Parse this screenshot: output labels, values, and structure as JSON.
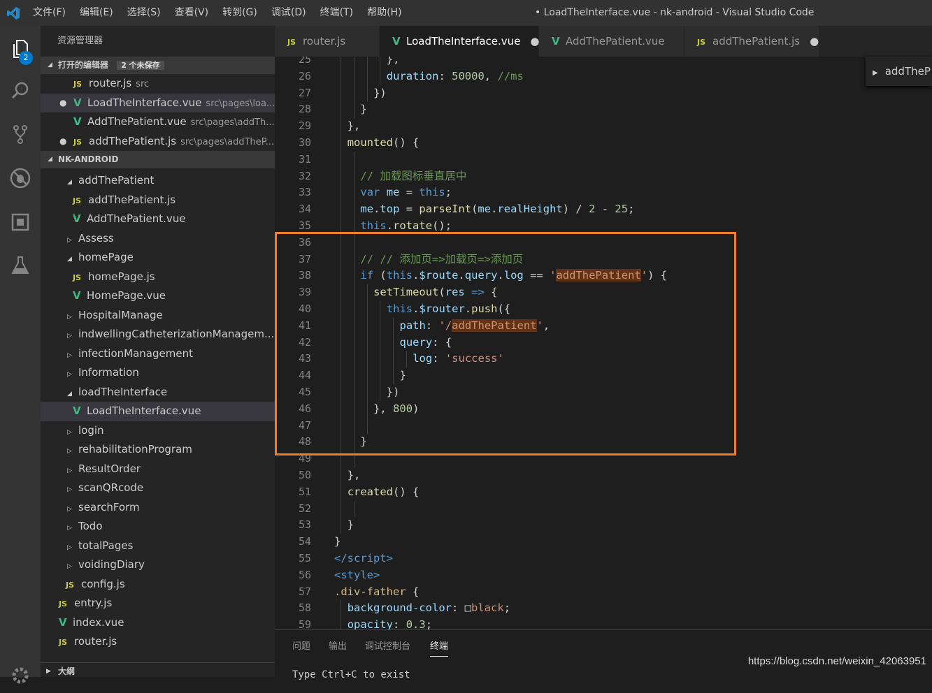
{
  "window": {
    "title": "• LoadTheInterface.vue - nk-android - Visual Studio Code"
  },
  "menu": [
    "文件(F)",
    "编辑(E)",
    "选择(S)",
    "查看(V)",
    "转到(G)",
    "调试(D)",
    "终端(T)",
    "帮助(H)"
  ],
  "activity": {
    "explorer_badge": "2"
  },
  "sidebar": {
    "title": "资源管理器",
    "open_editors": {
      "title": "打开的编辑器",
      "badge": "2 个未保存",
      "items": [
        {
          "icon": "JS",
          "name": "router.js",
          "desc": "src",
          "dot": false
        },
        {
          "icon": "V",
          "name": "LoadTheInterface.vue",
          "desc": "src\\pages\\loa...",
          "dot": true
        },
        {
          "icon": "V",
          "name": "AddThePatient.vue",
          "desc": "src\\pages\\addTh...",
          "dot": false
        },
        {
          "icon": "JS",
          "name": "addThePatient.js",
          "desc": "src\\pages\\addTheP...",
          "dot": true
        }
      ]
    },
    "project": {
      "title": "NK-ANDROID",
      "items": [
        {
          "type": "folder-open",
          "name": "addThePatient",
          "indent": 2
        },
        {
          "type": "js",
          "name": "addThePatient.js",
          "indent": 3
        },
        {
          "type": "vue",
          "name": "AddThePatient.vue",
          "indent": 3
        },
        {
          "type": "folder",
          "name": "Assess",
          "indent": 2
        },
        {
          "type": "folder-open",
          "name": "homePage",
          "indent": 2
        },
        {
          "type": "js",
          "name": "homePage.js",
          "indent": 3
        },
        {
          "type": "vue",
          "name": "HomePage.vue",
          "indent": 3
        },
        {
          "type": "folder",
          "name": "HospitalManage",
          "indent": 2
        },
        {
          "type": "folder",
          "name": "indwellingCatheterizationManagem...",
          "indent": 2
        },
        {
          "type": "folder",
          "name": "infectionManagement",
          "indent": 2
        },
        {
          "type": "folder",
          "name": "Information",
          "indent": 2
        },
        {
          "type": "folder-open",
          "name": "loadTheInterface",
          "indent": 2
        },
        {
          "type": "vue",
          "name": "LoadTheInterface.vue",
          "indent": 3,
          "selected": true
        },
        {
          "type": "folder",
          "name": "login",
          "indent": 2
        },
        {
          "type": "folder",
          "name": "rehabilitationProgram",
          "indent": 2
        },
        {
          "type": "folder",
          "name": "ResultOrder",
          "indent": 2
        },
        {
          "type": "folder",
          "name": "scanQRcode",
          "indent": 2
        },
        {
          "type": "folder",
          "name": "searchForm",
          "indent": 2
        },
        {
          "type": "folder",
          "name": "Todo",
          "indent": 2
        },
        {
          "type": "folder",
          "name": "totalPages",
          "indent": 2
        },
        {
          "type": "folder",
          "name": "voidingDiary",
          "indent": 2
        },
        {
          "type": "js",
          "name": "config.js",
          "indent": 2
        },
        {
          "type": "js",
          "name": "entry.js",
          "indent": 1
        },
        {
          "type": "vue",
          "name": "index.vue",
          "indent": 1
        },
        {
          "type": "js",
          "name": "router.js",
          "indent": 1
        }
      ]
    },
    "outline_title": "大纲"
  },
  "tabs": [
    {
      "icon": "JS",
      "label": "router.js",
      "active": false,
      "dirty": false
    },
    {
      "icon": "V",
      "label": "LoadTheInterface.vue",
      "active": true,
      "dirty": true
    },
    {
      "icon": "V",
      "label": "AddThePatient.vue",
      "active": false,
      "dirty": false
    },
    {
      "icon": "JS",
      "label": "addThePatient.js",
      "active": false,
      "dirty": true
    }
  ],
  "outline_popup": {
    "label": "addTheP"
  },
  "editor": {
    "lines": [
      {
        "n": "25",
        "indent": 4,
        "t": [
          [
            "plain",
            "},"
          ]
        ]
      },
      {
        "n": "26",
        "indent": 4,
        "t": [
          [
            "var",
            "duration"
          ],
          [
            "plain",
            ": "
          ],
          [
            "num",
            "50000"
          ],
          [
            "plain",
            ", "
          ],
          [
            "com",
            "//ms"
          ]
        ]
      },
      {
        "n": "27",
        "indent": 3,
        "t": [
          [
            "plain",
            "})"
          ]
        ]
      },
      {
        "n": "28",
        "indent": 2,
        "t": [
          [
            "plain",
            "}"
          ]
        ]
      },
      {
        "n": "29",
        "indent": 1,
        "t": [
          [
            "plain",
            "},"
          ]
        ]
      },
      {
        "n": "30",
        "indent": 1,
        "t": [
          [
            "fn",
            "mounted"
          ],
          [
            "plain",
            "() {"
          ]
        ]
      },
      {
        "n": "31",
        "indent": 2,
        "t": []
      },
      {
        "n": "32",
        "indent": 2,
        "t": [
          [
            "com",
            "// 加载图标垂直居中"
          ]
        ]
      },
      {
        "n": "33",
        "indent": 2,
        "t": [
          [
            "kw",
            "var"
          ],
          [
            "plain",
            " "
          ],
          [
            "var",
            "me"
          ],
          [
            "plain",
            " = "
          ],
          [
            "kw",
            "this"
          ],
          [
            "plain",
            ";"
          ]
        ]
      },
      {
        "n": "34",
        "indent": 2,
        "t": [
          [
            "var",
            "me"
          ],
          [
            "plain",
            "."
          ],
          [
            "var",
            "top"
          ],
          [
            "plain",
            " = "
          ],
          [
            "fn",
            "parseInt"
          ],
          [
            "plain",
            "("
          ],
          [
            "var",
            "me"
          ],
          [
            "plain",
            "."
          ],
          [
            "var",
            "realHeight"
          ],
          [
            "plain",
            ") / "
          ],
          [
            "num",
            "2"
          ],
          [
            "plain",
            " - "
          ],
          [
            "num",
            "25"
          ],
          [
            "plain",
            ";"
          ]
        ]
      },
      {
        "n": "35",
        "indent": 2,
        "t": [
          [
            "kw",
            "this"
          ],
          [
            "plain",
            "."
          ],
          [
            "fn",
            "rotate"
          ],
          [
            "plain",
            "();"
          ]
        ]
      },
      {
        "n": "36",
        "indent": 2,
        "t": []
      },
      {
        "n": "37",
        "indent": 2,
        "t": [
          [
            "com",
            "// // 添加页=>加载页=>添加页"
          ]
        ]
      },
      {
        "n": "38",
        "indent": 2,
        "t": [
          [
            "kw",
            "if"
          ],
          [
            "plain",
            " ("
          ],
          [
            "kw",
            "this"
          ],
          [
            "plain",
            "."
          ],
          [
            "var",
            "$route"
          ],
          [
            "plain",
            "."
          ],
          [
            "var",
            "query"
          ],
          [
            "plain",
            "."
          ],
          [
            "var",
            "log"
          ],
          [
            "plain",
            " == "
          ],
          [
            "str",
            "'"
          ],
          [
            "hl",
            "addThePatient"
          ],
          [
            "str",
            "'"
          ],
          [
            "plain",
            ") {"
          ]
        ]
      },
      {
        "n": "39",
        "indent": 3,
        "t": [
          [
            "fn",
            "setTimeout"
          ],
          [
            "plain",
            "("
          ],
          [
            "var",
            "res"
          ],
          [
            "plain",
            " "
          ],
          [
            "kw",
            "=>"
          ],
          [
            "plain",
            " {"
          ]
        ]
      },
      {
        "n": "40",
        "indent": 4,
        "t": [
          [
            "kw",
            "this"
          ],
          [
            "plain",
            "."
          ],
          [
            "var",
            "$router"
          ],
          [
            "plain",
            "."
          ],
          [
            "fn",
            "push"
          ],
          [
            "plain",
            "({"
          ]
        ]
      },
      {
        "n": "41",
        "indent": 5,
        "t": [
          [
            "var",
            "path"
          ],
          [
            "plain",
            ": "
          ],
          [
            "str",
            "'/"
          ],
          [
            "hl",
            "addThePatient"
          ],
          [
            "str",
            "'"
          ],
          [
            "plain",
            ","
          ]
        ]
      },
      {
        "n": "42",
        "indent": 5,
        "t": [
          [
            "var",
            "query"
          ],
          [
            "plain",
            ": {"
          ]
        ]
      },
      {
        "n": "43",
        "indent": 6,
        "t": [
          [
            "var",
            "log"
          ],
          [
            "plain",
            ": "
          ],
          [
            "str",
            "'success'"
          ]
        ]
      },
      {
        "n": "44",
        "indent": 5,
        "t": [
          [
            "plain",
            "}"
          ]
        ]
      },
      {
        "n": "45",
        "indent": 4,
        "t": [
          [
            "plain",
            "})"
          ]
        ]
      },
      {
        "n": "46",
        "indent": 3,
        "t": [
          [
            "plain",
            "}, "
          ],
          [
            "num",
            "800"
          ],
          [
            "plain",
            ")"
          ]
        ]
      },
      {
        "n": "47",
        "indent": 3,
        "t": []
      },
      {
        "n": "48",
        "indent": 2,
        "t": [
          [
            "plain",
            "}"
          ]
        ]
      },
      {
        "n": "49",
        "indent": 2,
        "t": []
      },
      {
        "n": "50",
        "indent": 1,
        "t": [
          [
            "plain",
            "},"
          ]
        ]
      },
      {
        "n": "51",
        "indent": 1,
        "t": [
          [
            "fn",
            "created"
          ],
          [
            "plain",
            "() {"
          ]
        ]
      },
      {
        "n": "52",
        "indent": 2,
        "t": []
      },
      {
        "n": "53",
        "indent": 1,
        "t": [
          [
            "plain",
            "}"
          ]
        ]
      },
      {
        "n": "54",
        "indent": 0,
        "t": [
          [
            "plain",
            "}"
          ]
        ]
      },
      {
        "n": "55",
        "indent": 0,
        "t": [
          [
            "tag",
            "</"
          ],
          [
            "tag",
            "script"
          ],
          [
            "tag",
            ">"
          ]
        ]
      },
      {
        "n": "56",
        "indent": 0,
        "t": [
          [
            "tag",
            "<"
          ],
          [
            "tag",
            "style"
          ],
          [
            "tag",
            ">"
          ]
        ]
      },
      {
        "n": "57",
        "indent": 0,
        "t": [
          [
            "sel",
            ".div-father"
          ],
          [
            "plain",
            " {"
          ]
        ]
      },
      {
        "n": "58",
        "indent": 1,
        "t": [
          [
            "prop",
            "background-color"
          ],
          [
            "plain",
            ": "
          ],
          [
            "box",
            "□"
          ],
          [
            "str",
            "black"
          ],
          [
            "plain",
            ";"
          ]
        ]
      },
      {
        "n": "59",
        "indent": 1,
        "t": [
          [
            "prop",
            "opacity"
          ],
          [
            "plain",
            ": "
          ],
          [
            "num",
            "0.3"
          ],
          [
            "plain",
            ";"
          ]
        ]
      }
    ]
  },
  "panel": {
    "tabs": [
      "问题",
      "输出",
      "调试控制台",
      "终端"
    ],
    "active": "终端",
    "terminal_text": "Type Ctrl+C to exist"
  },
  "watermark": "https://blog.csdn.net/weixin_42063951",
  "colors": {
    "highlight_box": "#f07f2a",
    "accent": "#007acc"
  }
}
